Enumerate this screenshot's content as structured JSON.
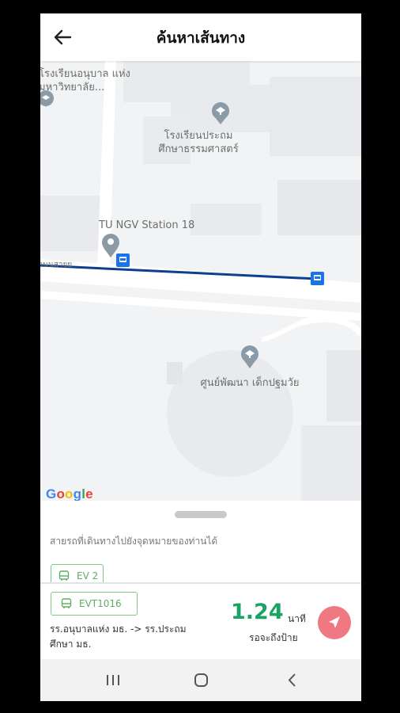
{
  "header": {
    "title": "ค้นหาเส้นทาง",
    "back_icon": "arrow-left-icon"
  },
  "map": {
    "labels": {
      "school_top_left": "โรงเรียนอนุบาล แห่งมหาวิทยาลัย...",
      "school_primary": "โรงเรียนประถม ศึกษาธรรมศาสตร์",
      "station": "TU NGV Station 18",
      "road": "ถนนสายย",
      "child_center": "ศูนย์พัฒนา เด็กปฐมวัย"
    },
    "route_color": "#0d3f8f",
    "poi_color": "#8a9aa6",
    "bus_stop_color": "#1a73e8",
    "attribution": "Google"
  },
  "sheet": {
    "available_routes_label": "สายรถที่เดินทางไปยังจุดหมายของท่านได้",
    "route_chip": "EV 2"
  },
  "info": {
    "bus_chip": "EVT1016",
    "route_text": "รร.อนุบาลแห่ง มธ. -> รร.ประถม ศึกษา มธ.",
    "eta_value": "1.24",
    "eta_unit": "นาที",
    "eta_label": "รอจะถึงป้าย",
    "nav_button_icon": "navigation-arrow-icon",
    "accent": "#19a463",
    "button_color": "#f07883"
  },
  "system_nav": {
    "recents_icon": "recents-icon",
    "home_icon": "home-circle-icon",
    "back_icon": "chevron-left-icon"
  }
}
